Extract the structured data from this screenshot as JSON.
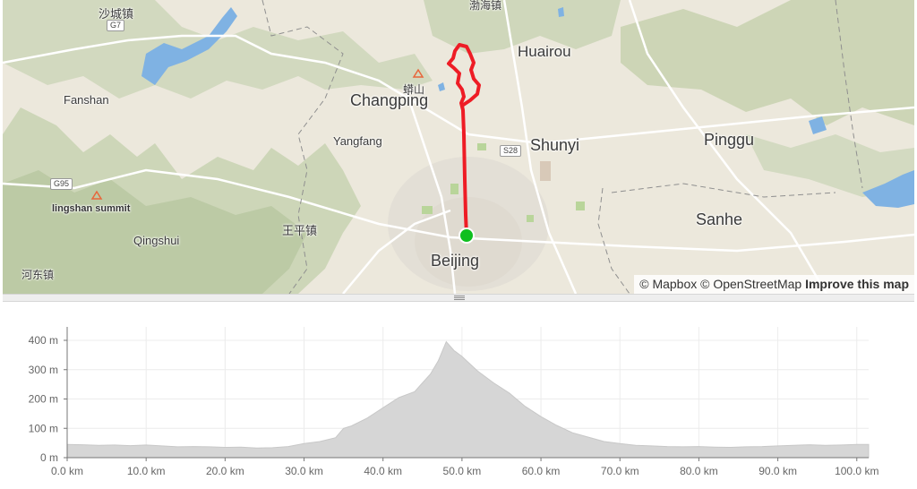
{
  "map": {
    "labels": {
      "shacheng": "沙城镇",
      "bohai": "渤海镇",
      "huairou": "Huairou",
      "mangshan": "蟒山",
      "changping": "Changping",
      "fanshan": "Fanshan",
      "yangfang": "Yangfang",
      "shunyi": "Shunyi",
      "pinggu": "Pinggu",
      "lingshan": "lingshan summit",
      "wangping": "王平镇",
      "qingshui": "Qingshui",
      "sanhe": "Sanhe",
      "beijing": "Beijing",
      "hedong": "河东镇"
    },
    "shields": {
      "g7": "G7",
      "s28": "S28",
      "g95": "G95"
    },
    "route_color": "#ee1c25",
    "start_marker_color": "#0fbf1f",
    "attribution": {
      "mapbox": "© Mapbox",
      "osm": "© OpenStreetMap",
      "improve": "Improve this map"
    }
  },
  "chart_data": {
    "type": "area",
    "title": "",
    "xlabel": "",
    "ylabel": "",
    "x_unit": "km",
    "y_unit": "m",
    "xlim": [
      0,
      101.5
    ],
    "ylim": [
      0,
      400
    ],
    "x_ticks": [
      "0.0 km",
      "10.0 km",
      "20.0 km",
      "30.0 km",
      "40.0 km",
      "50.0 km",
      "60.0 km",
      "70.0 km",
      "80.0 km",
      "90.0 km",
      "100.0 km"
    ],
    "y_ticks": [
      "0 m",
      "100 m",
      "200 m",
      "300 m",
      "400 m"
    ],
    "grid": true,
    "fill_color": "#d6d6d6",
    "x": [
      0,
      2,
      4,
      6,
      8,
      10,
      12,
      14,
      16,
      18,
      20,
      22,
      24,
      26,
      28,
      30,
      32,
      34,
      35,
      36,
      38,
      40,
      42,
      44,
      45,
      46,
      47,
      48,
      49,
      50,
      51,
      52,
      54,
      56,
      58,
      60,
      62,
      64,
      66,
      68,
      70,
      72,
      74,
      76,
      78,
      80,
      82,
      84,
      86,
      88,
      90,
      92,
      94,
      96,
      98,
      100,
      101.5
    ],
    "y": [
      45,
      44,
      42,
      43,
      41,
      43,
      40,
      37,
      38,
      37,
      35,
      36,
      33,
      34,
      38,
      48,
      55,
      68,
      100,
      108,
      135,
      170,
      205,
      225,
      255,
      285,
      330,
      395,
      365,
      345,
      320,
      295,
      255,
      220,
      175,
      140,
      110,
      85,
      70,
      55,
      48,
      42,
      40,
      38,
      37,
      38,
      36,
      35,
      37,
      38,
      40,
      42,
      44,
      42,
      43,
      45,
      45
    ]
  }
}
